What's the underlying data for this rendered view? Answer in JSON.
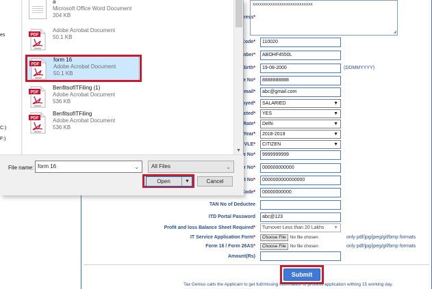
{
  "dialog": {
    "nav_items": [
      "es",
      "C:)",
      "F:)"
    ],
    "files": [
      {
        "name": "a",
        "type": "Microsoft Office Word Document",
        "size": "304 KB",
        "icon": "word-document-icon"
      },
      {
        "name": "",
        "type": "Adobe Acrobat Document",
        "size": "50.1 KB",
        "icon": "pdf-icon"
      },
      {
        "name": "form 16",
        "type": "Adobe Acrobat Document",
        "size": "50.1 KB",
        "icon": "pdf-icon",
        "selected": true
      },
      {
        "name": "BenfitsofITFiling (1)",
        "type": "Adobe Acrobat Document",
        "size": "536 KB",
        "icon": "pdf-icon"
      },
      {
        "name": "BenfitsofITFiling",
        "type": "Adobe Acrobat Document",
        "size": "536 KB",
        "icon": "pdf-icon"
      }
    ],
    "pdf_badge": "PDF",
    "pdf_brand": "Adobe",
    "file_name_label": "File name:",
    "file_name_value": "form 16",
    "filter_value": "All Files",
    "open_label": "Open",
    "cancel_label": "Cancel"
  },
  "form": {
    "address_label": "ress",
    "address_value": "xxxxxxxxxxxxxxxxxxxxxxxxxxx",
    "rows": [
      {
        "label": "Code",
        "value": "110020",
        "kind": "input"
      },
      {
        "label": "mber",
        "value": "ABOHF4550L",
        "kind": "input"
      },
      {
        "label": "Birth",
        "value": "19-08-2000",
        "kind": "input",
        "hint": "(DDMMYYYY)"
      },
      {
        "label": "e No",
        "value": "8888888888",
        "kind": "input"
      },
      {
        "label": "mail",
        "value": "abc@gmail.com",
        "kind": "input"
      },
      {
        "label": "oyed",
        "value": "SALARIED",
        "kind": "select"
      },
      {
        "label": "cted",
        "value": "YES",
        "kind": "select"
      },
      {
        "label": "Rate",
        "value": "Delhi",
        "kind": "select"
      },
      {
        "label": "Year",
        "value": "2018-2019",
        "kind": "select"
      },
      {
        "label": "VLE",
        "value": "CITIZEN",
        "kind": "select"
      },
      {
        "label": "e No",
        "value": "9999999999",
        "kind": "input"
      },
      {
        "label": "r No",
        "value": "000000000000",
        "kind": "input"
      },
      {
        "label": "t No",
        "value": "0000000000000000",
        "kind": "input"
      },
      {
        "label": "Code",
        "value": "00000000000",
        "kind": "input"
      },
      {
        "label": "TAN No of Deductee",
        "value": "",
        "kind": "input",
        "required": false
      },
      {
        "label": "ITD Portal Password",
        "value": "abc@123",
        "kind": "input",
        "required": false
      },
      {
        "label": "Profit and loss Balance Sheet Required",
        "value": "Turnover Less than 20 Lakhs",
        "kind": "select-grey"
      }
    ],
    "file_rows": [
      {
        "label": "IT Service Application Form",
        "button": "Choose File",
        "status": "No file chosen",
        "hint": "only pdf/jpg/jpeg/gif/bmp formats"
      },
      {
        "label": "Form 16 / Form 26AS",
        "button": "Choose File",
        "status": "No file chosen",
        "hint": "only pdf/jpg/jpeg/gif/bmp formats"
      }
    ],
    "amount_label": "Amount(Rs)",
    "amount_value": "",
    "submit_label": "Submit",
    "footer_note": "Tax Genius calls the Applicant to get full/missing information to process application withing 15 working day."
  }
}
